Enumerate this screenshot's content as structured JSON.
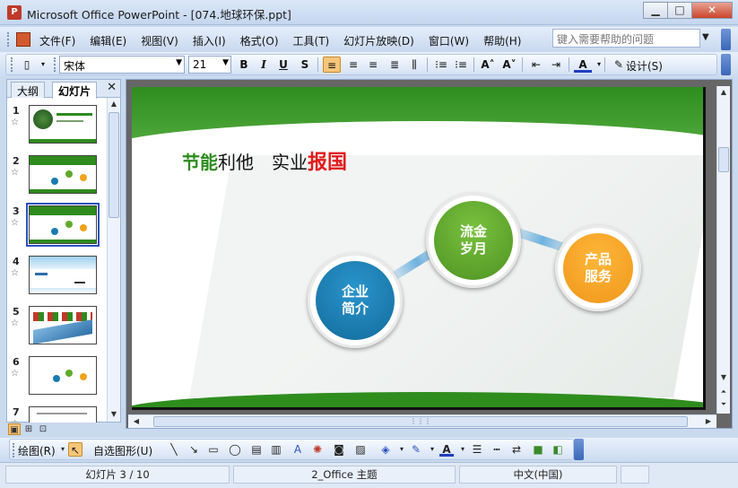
{
  "window": {
    "title": "Microsoft Office PowerPoint - [074.地球环保.ppt]",
    "app_icon": "P",
    "min_label": "▁",
    "max_label": "□",
    "close_label": "✕"
  },
  "menu": {
    "items": [
      "文件(F)",
      "编辑(E)",
      "视图(V)",
      "插入(I)",
      "格式(O)",
      "工具(T)",
      "幻灯片放映(D)",
      "窗口(W)",
      "帮助(H)"
    ],
    "help_placeholder": "键入需要帮助的问题",
    "help_dropdown": "▼",
    "close": "✕"
  },
  "format_toolbar": {
    "font_name": "宋体",
    "font_size": "21",
    "bold": "B",
    "italic": "I",
    "underline": "U",
    "shadow": "S",
    "align_left": "≡",
    "align_center": "≡",
    "align_right": "≡",
    "justify": "≣",
    "vertical": "⫼",
    "numbering": "⁝≡",
    "bullets": "⁝≡",
    "grow_font": "A˄",
    "shrink_font": "A˅",
    "decrease_indent": "⇤",
    "increase_indent": "⇥",
    "font_color": "A",
    "design": "设计(S)"
  },
  "left_pane": {
    "tabs": [
      "大纲",
      "幻灯片"
    ],
    "close": "✕",
    "slides": [
      {
        "num": "1",
        "star": "☆"
      },
      {
        "num": "2",
        "star": "☆"
      },
      {
        "num": "3",
        "star": "☆"
      },
      {
        "num": "4",
        "star": "☆"
      },
      {
        "num": "5",
        "star": "☆"
      },
      {
        "num": "6",
        "star": "☆"
      },
      {
        "num": "7",
        "star": "☆"
      }
    ],
    "selected": 3
  },
  "slide": {
    "title_part1": "节能",
    "title_part2": "利他　实业",
    "title_part3": "报国",
    "circles": [
      {
        "line1": "企业",
        "line2": "简介",
        "color": "#1b7bb0"
      },
      {
        "line1": "流金",
        "line2": "岁月",
        "color": "#5faa2b"
      },
      {
        "line1": "产品",
        "line2": "服务",
        "color": "#f2a21b"
      }
    ],
    "accent_green": "#2f8d1e",
    "accent_red": "#e11b1b"
  },
  "draw_toolbar": {
    "draw": "绘图(R)",
    "autoshapes": "自选图形(U)"
  },
  "status": {
    "slide_info": "幻灯片 3 / 10",
    "theme": "2_Office 主题",
    "language": "中文(中国)"
  }
}
